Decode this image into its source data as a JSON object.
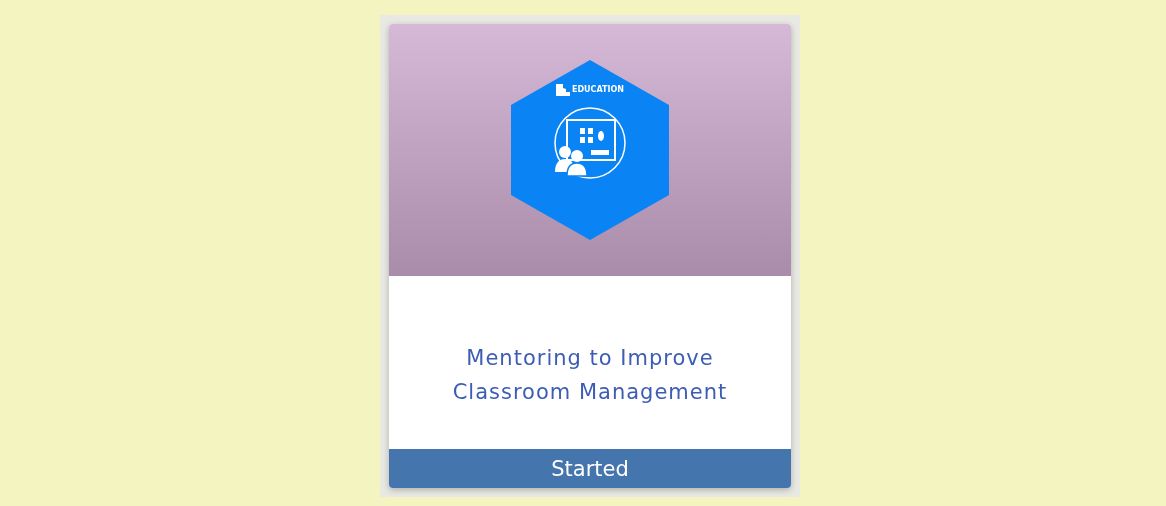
{
  "card": {
    "badge_logo_text": "EDUCATION",
    "title": "Mentoring to Improve Classroom Management",
    "status": "Started"
  }
}
